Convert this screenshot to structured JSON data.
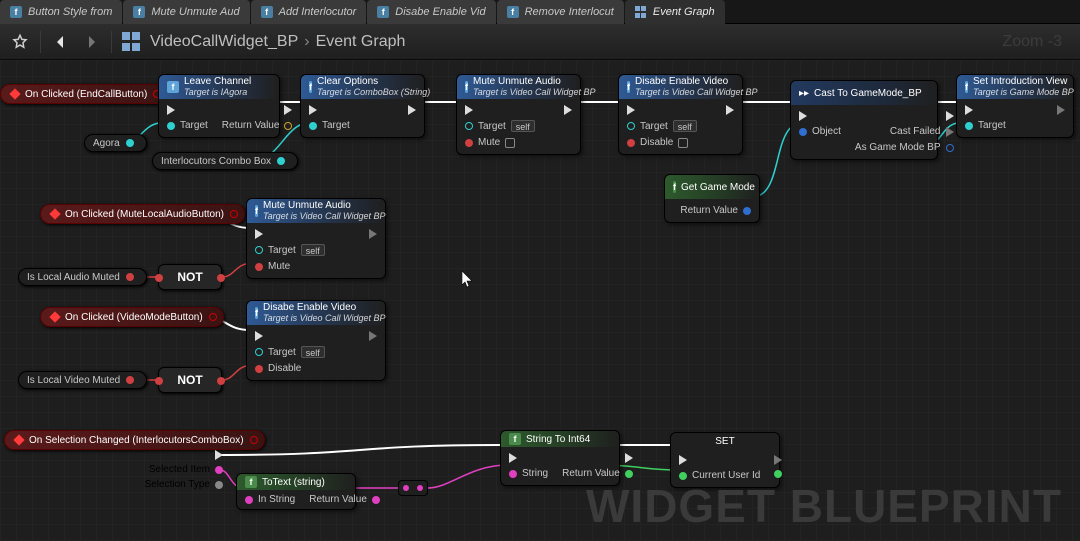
{
  "tabs": [
    {
      "label": "Button Style from"
    },
    {
      "label": "Mute Unmute Aud"
    },
    {
      "label": "Add Interlocutor"
    },
    {
      "label": "Disabe Enable Vid"
    },
    {
      "label": "Remove Interlocut"
    },
    {
      "label": "Event Graph",
      "active": true
    }
  ],
  "breadcrumb": {
    "asset": "VideoCallWidget_BP",
    "graph": "Event Graph"
  },
  "zoom_label": "Zoom -3",
  "watermark": "WIDGET BLUEPRINT",
  "events": {
    "end_call": {
      "label": "On Clicked (EndCallButton)"
    },
    "mute_local": {
      "label": "On Clicked (MuteLocalAudioButton)"
    },
    "video_mode": {
      "label": "On Clicked (VideoModeButton)"
    },
    "sel_changed": {
      "label": "On Selection Changed (InterlocutorsComboBox)"
    }
  },
  "vars": {
    "agora": "Agora",
    "combo": "Interlocutors Combo Box",
    "local_audio_muted": "Is Local Audio Muted",
    "local_video_muted": "Is Local Video Muted"
  },
  "sel_changed_pins": {
    "sel_item": "Selected Item",
    "sel_type": "Selection Type"
  },
  "nodes": {
    "leave_channel": {
      "title": "Leave Channel",
      "sub": "Target is IAgora",
      "in": [
        "Target"
      ],
      "out": [
        "Return Value"
      ]
    },
    "clear_options": {
      "title": "Clear Options",
      "sub": "Target is ComboBox (String)",
      "in": [
        "Target"
      ]
    },
    "mute_unmute_a": {
      "title": "Mute Unmute Audio",
      "sub": "Target is Video Call Widget BP",
      "in": [
        "Target",
        "Mute"
      ],
      "self": true
    },
    "disable_video_a": {
      "title": "Disabe Enable Video",
      "sub": "Target is Video Call Widget BP",
      "in": [
        "Target",
        "Disable"
      ],
      "self": true
    },
    "cast": {
      "title": "Cast To GameMode_BP",
      "in": [
        "Object"
      ],
      "out": [
        "Cast Failed",
        "As Game Mode BP"
      ]
    },
    "set_intro": {
      "title": "Set Introduction View",
      "sub": "Target is Game Mode BP",
      "in": [
        "Target"
      ]
    },
    "get_gm": {
      "title": "Get Game Mode",
      "out": [
        "Return Value"
      ]
    },
    "mute_unmute_b": {
      "title": "Mute Unmute Audio",
      "sub": "Target is Video Call Widget BP",
      "in": [
        "Target",
        "Mute"
      ],
      "self": true
    },
    "disable_video_b": {
      "title": "Disabe Enable Video",
      "sub": "Target is Video Call Widget BP",
      "in": [
        "Target",
        "Disable"
      ],
      "self": true
    },
    "totext": {
      "title": "ToText (string)",
      "in_lbl": "In String",
      "out_lbl": "Return Value"
    },
    "str_to_int": {
      "title": "String To Int64",
      "in_lbl": "String",
      "out_lbl": "Return Value"
    },
    "set": {
      "title": "SET",
      "pin": "Current User Id"
    }
  },
  "not_label": "NOT",
  "self_chip": "self"
}
